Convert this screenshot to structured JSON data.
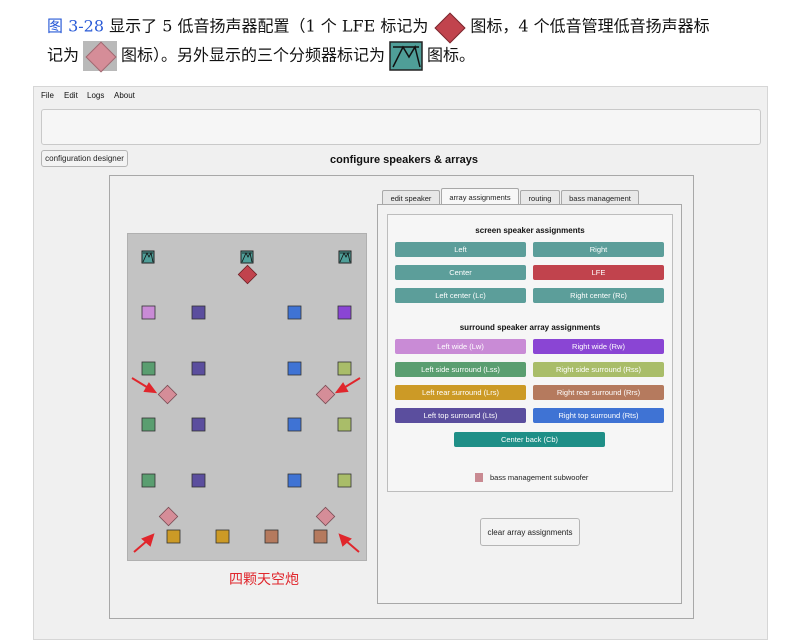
{
  "caption": {
    "line1_figref": "图 3-28",
    "line1_a": "显示了 5 低音扬声器配置（1 个 LFE 标记为",
    "line1_b": "图标，4 个低音管理低音扬声器标",
    "line2_a": "记为",
    "line2_b": "图标）。另外显示的三个分频器标记为",
    "line2_c": "图标。"
  },
  "menu": [
    "File",
    "Edit",
    "Logs",
    "About"
  ],
  "config_designer_label": "configuration designer",
  "title": "configure speakers & arrays",
  "tabs": [
    {
      "label": "edit speaker",
      "active": false
    },
    {
      "label": "array assignments",
      "active": true
    },
    {
      "label": "routing",
      "active": false
    },
    {
      "label": "bass management",
      "active": false
    }
  ],
  "screen_section_title": "screen speaker assignments",
  "screen_buttons": [
    {
      "label": "Left",
      "color": "#5c9e9a"
    },
    {
      "label": "Right",
      "color": "#5c9e9a"
    },
    {
      "label": "Center",
      "color": "#5c9e9a"
    },
    {
      "label": "LFE",
      "color": "#c1434d"
    },
    {
      "label": "Left center (Lc)",
      "color": "#5c9e9a"
    },
    {
      "label": "Right center (Rc)",
      "color": "#5c9e9a"
    }
  ],
  "surround_section_title": "surround speaker array assignments",
  "surround_buttons": [
    {
      "label": "Left wide (Lw)",
      "color": "#c98bd6"
    },
    {
      "label": "Right wide (Rw)",
      "color": "#8a45d4"
    },
    {
      "label": "Left side surround (Lss)",
      "color": "#5a9e70"
    },
    {
      "label": "Right side surround (Rss)",
      "color": "#a9bd69"
    },
    {
      "label": "Left rear surround (Lrs)",
      "color": "#cc9a26"
    },
    {
      "label": "Right rear surround (Rrs)",
      "color": "#b57a5e"
    },
    {
      "label": "Left top surround (Lts)",
      "color": "#5b4e9e"
    },
    {
      "label": "Right top surround (Rts)",
      "color": "#3f73d4"
    },
    {
      "label": "Center back (Cb)",
      "color": "#1f8f87"
    }
  ],
  "legend_label": "bass management subwoofer",
  "legend_color": "#c98a92",
  "clear_button_label": "clear array assignments",
  "overlay_label": "四颗天空炮",
  "colors": {
    "lfe": "#c1434d",
    "bass_sub": "#d58d98",
    "crossover_bg": "#4f9e98",
    "arrow": "#e0262c"
  },
  "speaker_icons": {
    "lfe": "diamond-lfe-icon",
    "bass_sub": "diamond-bass-sub-icon",
    "crossover": "crossover-icon",
    "speaker": "square-speaker-icon"
  }
}
